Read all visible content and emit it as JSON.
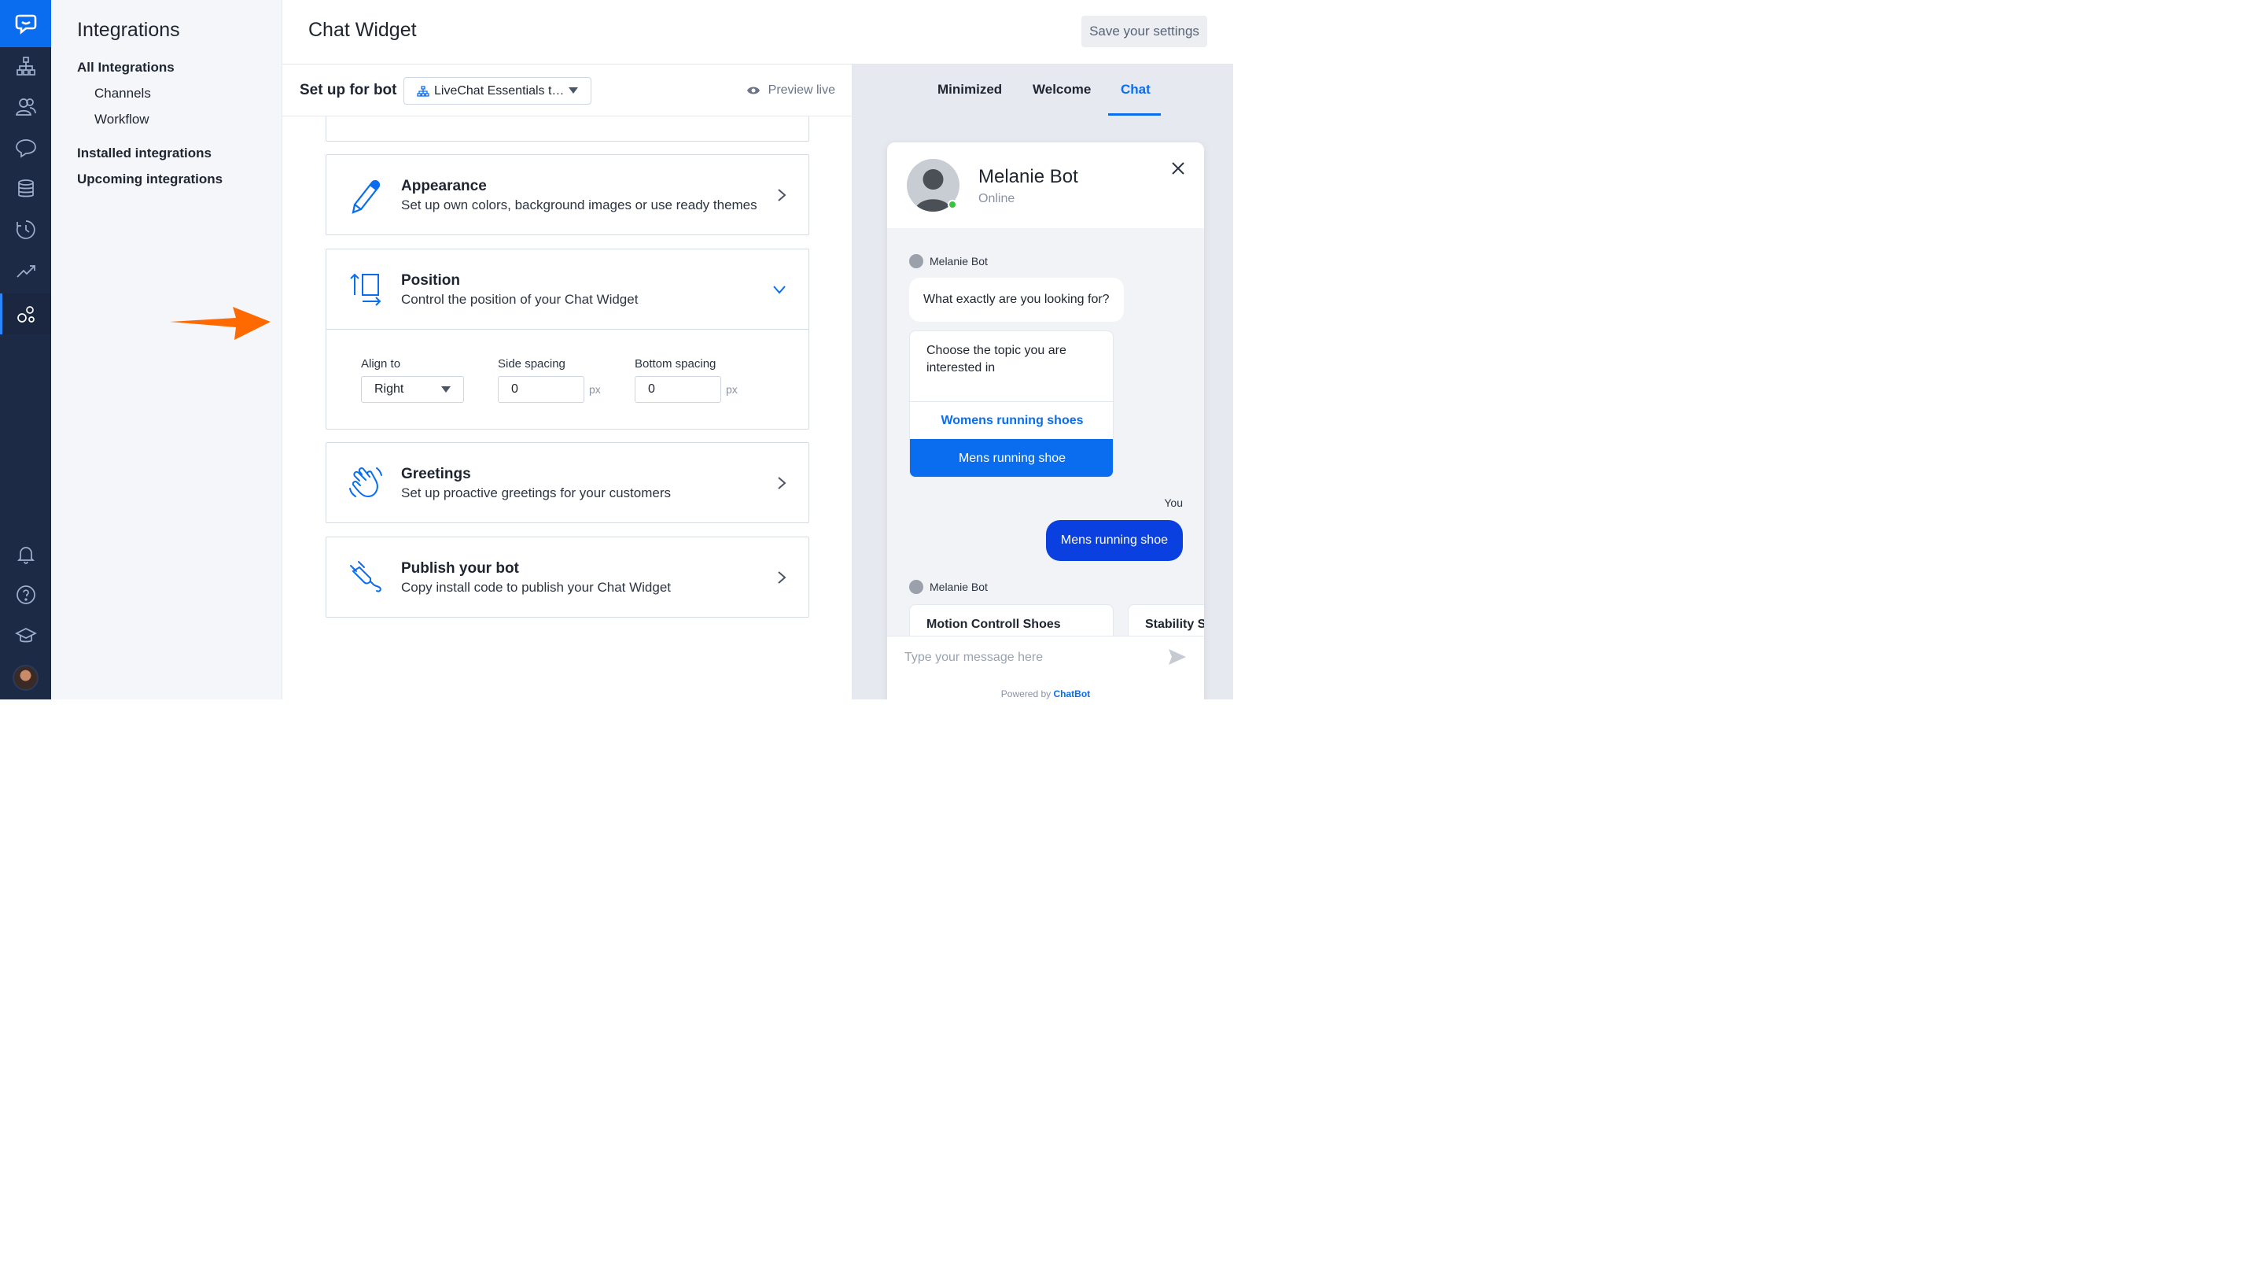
{
  "sidebar": {
    "title": "Integrations",
    "items": [
      {
        "label": "All Integrations"
      },
      {
        "label": "Channels"
      },
      {
        "label": "Workflow"
      },
      {
        "label": "Installed integrations"
      },
      {
        "label": "Upcoming integrations"
      }
    ]
  },
  "header": {
    "title": "Chat Widget",
    "save_label": "Save your settings"
  },
  "setup": {
    "label": "Set up for bot",
    "bot_selected": "LiveChat Essentials t…",
    "preview_label": "Preview live"
  },
  "cards": {
    "appearance": {
      "title": "Appearance",
      "desc": "Set up own colors, background images or use ready themes"
    },
    "position": {
      "title": "Position",
      "desc": "Control the position of your Chat Widget"
    },
    "greetings": {
      "title": "Greetings",
      "desc": "Set up proactive greetings for your customers"
    },
    "publish": {
      "title": "Publish your bot",
      "desc": "Copy install code to publish your Chat Widget"
    }
  },
  "position_form": {
    "align_label": "Align to",
    "align_value": "Right",
    "side_label": "Side spacing",
    "side_value": "0",
    "bottom_label": "Bottom spacing",
    "bottom_value": "0",
    "unit": "px"
  },
  "preview_tabs": {
    "minimized": "Minimized",
    "welcome": "Welcome",
    "chat": "Chat",
    "active": "Chat"
  },
  "widget": {
    "bot_name": "Melanie Bot",
    "status": "Online",
    "messages": {
      "sender": "Melanie Bot",
      "question": "What exactly are you looking for?",
      "choice_prompt": "Choose the topic you are interested in",
      "option_1": "Womens running shoes",
      "option_2": "Mens running shoe",
      "you_label": "You",
      "user_reply": "Mens running shoe",
      "sender_2": "Melanie Bot",
      "carousel_1": "Motion Controll Shoes",
      "carousel_2": "Stability S"
    },
    "input_placeholder": "Type your message here",
    "powered_by": "Powered by",
    "powered_brand": "ChatBot"
  },
  "colors": {
    "accent": "#0a6df0",
    "rail": "#1d2a46",
    "arrow": "#ff6a00",
    "user_bubble": "#0a3fe0"
  }
}
